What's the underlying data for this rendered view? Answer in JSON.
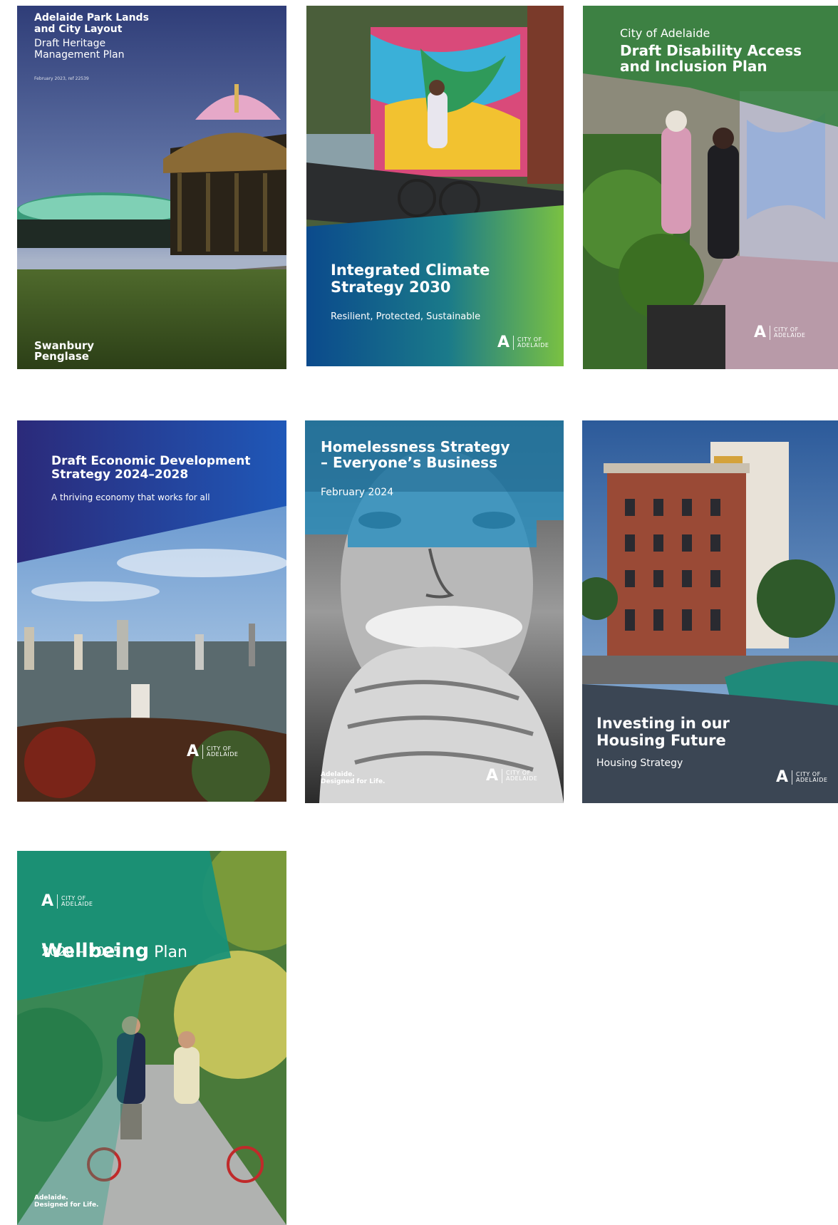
{
  "covers": [
    {
      "id": "heritage",
      "title": "Adelaide Park Lands\nand City Layout",
      "subtitle": "Draft Heritage\nManagement Plan",
      "date": "February 2023, ref 22539",
      "publisher": "Swanbury\nPenglase"
    },
    {
      "id": "climate",
      "title": "Integrated Climate\nStrategy 2030",
      "subtitle": "Resilient, Protected, Sustainable",
      "logo_wordmark": "CITY OF\nADELAIDE"
    },
    {
      "id": "disability",
      "kicker": "City of Adelaide",
      "title": "Draft Disability Access\nand Inclusion Plan",
      "logo_wordmark": "CITY OF\nADELAIDE"
    },
    {
      "id": "economic",
      "title": "Draft Economic Development\nStrategy 2024–2028",
      "subtitle": "A thriving economy that works for all",
      "logo_wordmark": "CITY OF\nADELAIDE"
    },
    {
      "id": "homelessness",
      "title": "Homelessness Strategy\n– Everyone’s Business",
      "date": "February 2024",
      "tagline": "Adelaide.\nDesigned for Life.",
      "logo_wordmark": "CITY OF\nADELAIDE"
    },
    {
      "id": "housing",
      "title": "Investing in our\nHousing Future",
      "subtitle": "Housing Strategy",
      "logo_wordmark": "CITY OF\nADELAIDE"
    },
    {
      "id": "wellbeing",
      "title_bold": "Wellbeing",
      "title_light": " Plan",
      "years": "2020 – 2025",
      "tagline": "Adelaide.\nDesigned for Life.",
      "logo_wordmark": "CITY OF\nADELAIDE"
    }
  ]
}
